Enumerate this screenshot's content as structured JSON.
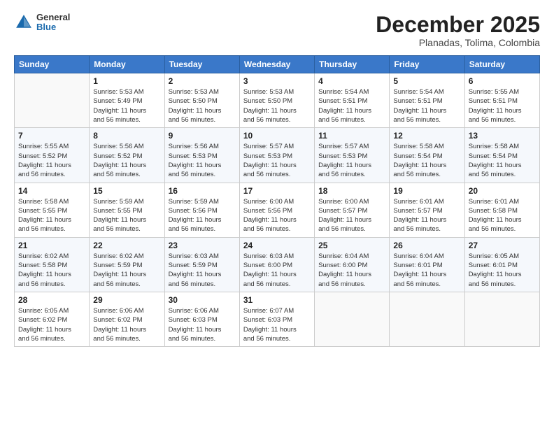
{
  "header": {
    "logo": {
      "general": "General",
      "blue": "Blue"
    },
    "title": "December 2025",
    "subtitle": "Planadas, Tolima, Colombia"
  },
  "days_of_week": [
    "Sunday",
    "Monday",
    "Tuesday",
    "Wednesday",
    "Thursday",
    "Friday",
    "Saturday"
  ],
  "weeks": [
    [
      {
        "num": "",
        "sunrise": "",
        "sunset": "",
        "daylight": ""
      },
      {
        "num": "1",
        "sunrise": "Sunrise: 5:53 AM",
        "sunset": "Sunset: 5:49 PM",
        "daylight": "Daylight: 11 hours and 56 minutes."
      },
      {
        "num": "2",
        "sunrise": "Sunrise: 5:53 AM",
        "sunset": "Sunset: 5:50 PM",
        "daylight": "Daylight: 11 hours and 56 minutes."
      },
      {
        "num": "3",
        "sunrise": "Sunrise: 5:53 AM",
        "sunset": "Sunset: 5:50 PM",
        "daylight": "Daylight: 11 hours and 56 minutes."
      },
      {
        "num": "4",
        "sunrise": "Sunrise: 5:54 AM",
        "sunset": "Sunset: 5:51 PM",
        "daylight": "Daylight: 11 hours and 56 minutes."
      },
      {
        "num": "5",
        "sunrise": "Sunrise: 5:54 AM",
        "sunset": "Sunset: 5:51 PM",
        "daylight": "Daylight: 11 hours and 56 minutes."
      },
      {
        "num": "6",
        "sunrise": "Sunrise: 5:55 AM",
        "sunset": "Sunset: 5:51 PM",
        "daylight": "Daylight: 11 hours and 56 minutes."
      }
    ],
    [
      {
        "num": "7",
        "sunrise": "Sunrise: 5:55 AM",
        "sunset": "Sunset: 5:52 PM",
        "daylight": "Daylight: 11 hours and 56 minutes."
      },
      {
        "num": "8",
        "sunrise": "Sunrise: 5:56 AM",
        "sunset": "Sunset: 5:52 PM",
        "daylight": "Daylight: 11 hours and 56 minutes."
      },
      {
        "num": "9",
        "sunrise": "Sunrise: 5:56 AM",
        "sunset": "Sunset: 5:53 PM",
        "daylight": "Daylight: 11 hours and 56 minutes."
      },
      {
        "num": "10",
        "sunrise": "Sunrise: 5:57 AM",
        "sunset": "Sunset: 5:53 PM",
        "daylight": "Daylight: 11 hours and 56 minutes."
      },
      {
        "num": "11",
        "sunrise": "Sunrise: 5:57 AM",
        "sunset": "Sunset: 5:53 PM",
        "daylight": "Daylight: 11 hours and 56 minutes."
      },
      {
        "num": "12",
        "sunrise": "Sunrise: 5:58 AM",
        "sunset": "Sunset: 5:54 PM",
        "daylight": "Daylight: 11 hours and 56 minutes."
      },
      {
        "num": "13",
        "sunrise": "Sunrise: 5:58 AM",
        "sunset": "Sunset: 5:54 PM",
        "daylight": "Daylight: 11 hours and 56 minutes."
      }
    ],
    [
      {
        "num": "14",
        "sunrise": "Sunrise: 5:58 AM",
        "sunset": "Sunset: 5:55 PM",
        "daylight": "Daylight: 11 hours and 56 minutes."
      },
      {
        "num": "15",
        "sunrise": "Sunrise: 5:59 AM",
        "sunset": "Sunset: 5:55 PM",
        "daylight": "Daylight: 11 hours and 56 minutes."
      },
      {
        "num": "16",
        "sunrise": "Sunrise: 5:59 AM",
        "sunset": "Sunset: 5:56 PM",
        "daylight": "Daylight: 11 hours and 56 minutes."
      },
      {
        "num": "17",
        "sunrise": "Sunrise: 6:00 AM",
        "sunset": "Sunset: 5:56 PM",
        "daylight": "Daylight: 11 hours and 56 minutes."
      },
      {
        "num": "18",
        "sunrise": "Sunrise: 6:00 AM",
        "sunset": "Sunset: 5:57 PM",
        "daylight": "Daylight: 11 hours and 56 minutes."
      },
      {
        "num": "19",
        "sunrise": "Sunrise: 6:01 AM",
        "sunset": "Sunset: 5:57 PM",
        "daylight": "Daylight: 11 hours and 56 minutes."
      },
      {
        "num": "20",
        "sunrise": "Sunrise: 6:01 AM",
        "sunset": "Sunset: 5:58 PM",
        "daylight": "Daylight: 11 hours and 56 minutes."
      }
    ],
    [
      {
        "num": "21",
        "sunrise": "Sunrise: 6:02 AM",
        "sunset": "Sunset: 5:58 PM",
        "daylight": "Daylight: 11 hours and 56 minutes."
      },
      {
        "num": "22",
        "sunrise": "Sunrise: 6:02 AM",
        "sunset": "Sunset: 5:59 PM",
        "daylight": "Daylight: 11 hours and 56 minutes."
      },
      {
        "num": "23",
        "sunrise": "Sunrise: 6:03 AM",
        "sunset": "Sunset: 5:59 PM",
        "daylight": "Daylight: 11 hours and 56 minutes."
      },
      {
        "num": "24",
        "sunrise": "Sunrise: 6:03 AM",
        "sunset": "Sunset: 6:00 PM",
        "daylight": "Daylight: 11 hours and 56 minutes."
      },
      {
        "num": "25",
        "sunrise": "Sunrise: 6:04 AM",
        "sunset": "Sunset: 6:00 PM",
        "daylight": "Daylight: 11 hours and 56 minutes."
      },
      {
        "num": "26",
        "sunrise": "Sunrise: 6:04 AM",
        "sunset": "Sunset: 6:01 PM",
        "daylight": "Daylight: 11 hours and 56 minutes."
      },
      {
        "num": "27",
        "sunrise": "Sunrise: 6:05 AM",
        "sunset": "Sunset: 6:01 PM",
        "daylight": "Daylight: 11 hours and 56 minutes."
      }
    ],
    [
      {
        "num": "28",
        "sunrise": "Sunrise: 6:05 AM",
        "sunset": "Sunset: 6:02 PM",
        "daylight": "Daylight: 11 hours and 56 minutes."
      },
      {
        "num": "29",
        "sunrise": "Sunrise: 6:06 AM",
        "sunset": "Sunset: 6:02 PM",
        "daylight": "Daylight: 11 hours and 56 minutes."
      },
      {
        "num": "30",
        "sunrise": "Sunrise: 6:06 AM",
        "sunset": "Sunset: 6:03 PM",
        "daylight": "Daylight: 11 hours and 56 minutes."
      },
      {
        "num": "31",
        "sunrise": "Sunrise: 6:07 AM",
        "sunset": "Sunset: 6:03 PM",
        "daylight": "Daylight: 11 hours and 56 minutes."
      },
      {
        "num": "",
        "sunrise": "",
        "sunset": "",
        "daylight": ""
      },
      {
        "num": "",
        "sunrise": "",
        "sunset": "",
        "daylight": ""
      },
      {
        "num": "",
        "sunrise": "",
        "sunset": "",
        "daylight": ""
      }
    ]
  ]
}
